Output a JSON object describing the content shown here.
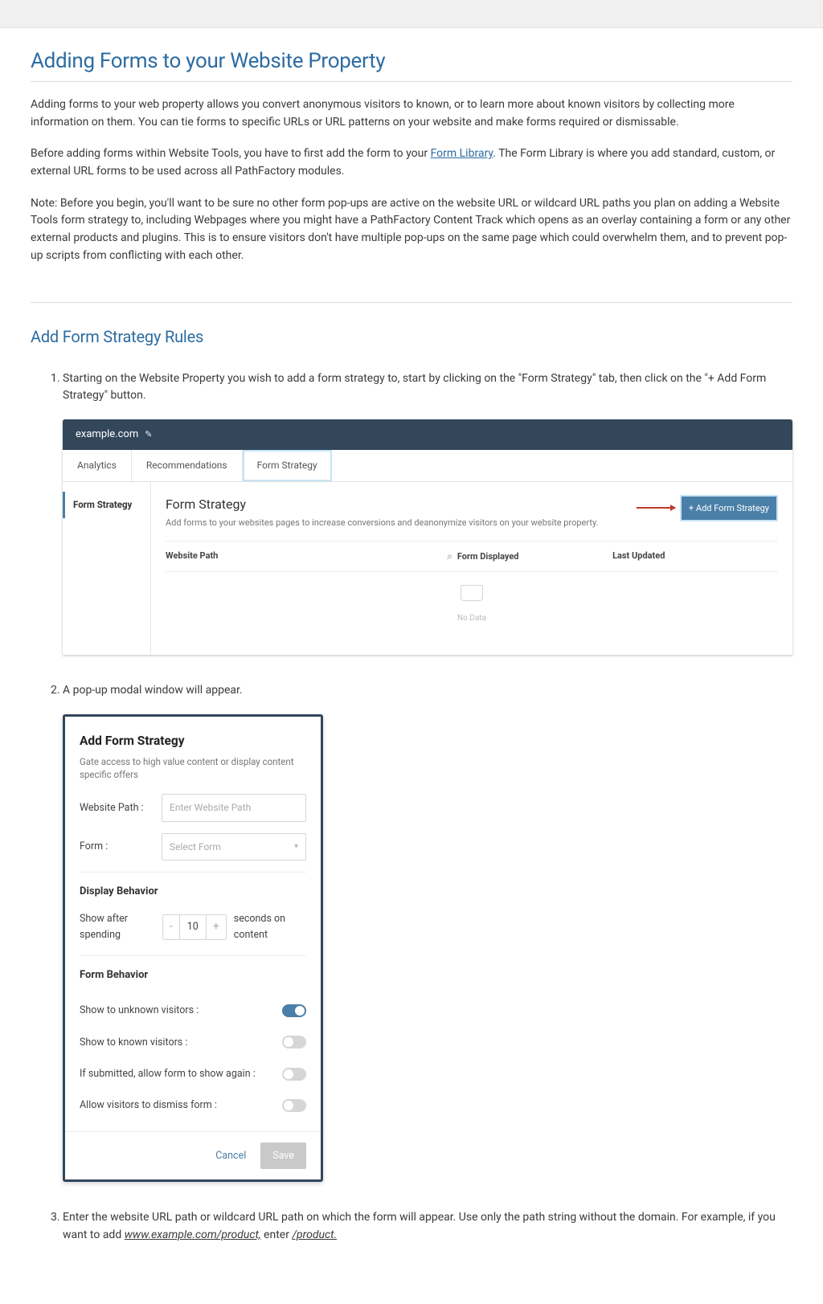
{
  "heading": "Adding Forms to your Website Property",
  "intro_p1": "Adding forms to your web property allows you convert anonymous visitors to known, or to learn more about known visitors by collecting more information on them. You can tie forms to specific URLs or URL patterns on your website and make forms required or dismissable.",
  "intro_p2_a": "Before adding forms within Website Tools, you have to first add the form to your ",
  "intro_p2_link": "Form Library",
  "intro_p2_b": ". The Form Library is where you add standard, custom, or external URL forms to be used across all PathFactory modules.",
  "intro_p3": "Note: Before you begin, you'll want to be sure no other form pop-ups are active on the website URL or wildcard URL paths you plan on adding a Website Tools form strategy to, including Webpages where you might have a PathFactory Content Track which opens as an overlay containing a form or any other external products and plugins. This is to ensure visitors don't have multiple pop-ups on the same page which could overwhelm them, and to prevent pop-up scripts from conflicting with each other.",
  "section_title": "Add Form Strategy Rules",
  "step1": "Starting on the Website Property you wish to add a form strategy to, start by clicking on the \"Form Strategy\" tab, then click on the \"+ Add Form Strategy\" button.",
  "step2": "A pop-up modal window will appear.",
  "step3_a": "Enter the website URL path or wildcard URL path on which the form will appear. Use only the path string without the domain. For example, if you want to add ",
  "step3_url1": "www.example.com/product,",
  "step3_b": " enter ",
  "step3_url2": "/product.",
  "shot1": {
    "breadcrumb": "example.com",
    "tabs": [
      "Analytics",
      "Recommendations",
      "Form Strategy"
    ],
    "side_item": "Form Strategy",
    "panel_title": "Form Strategy",
    "panel_sub": "Add forms to your websites pages to increase conversions and deanonymize visitors on your website property.",
    "btn_label": "+   Add Form Strategy",
    "col1": "Website Path",
    "col2": "Form Displayed",
    "col3": "Last Updated",
    "nodata": "No Data"
  },
  "shot2": {
    "title": "Add Form Strategy",
    "sub": "Gate access to high value content or display content specific offers",
    "website_path_label": "Website Path :",
    "website_path_ph": "Enter Website Path",
    "form_label": "Form :",
    "form_ph": "Select Form",
    "display_behavior": "Display Behavior",
    "show_after_a": "Show after spending",
    "spend_val": "10",
    "show_after_b": "seconds on content",
    "form_behavior": "Form Behavior",
    "t1": "Show to unknown visitors :",
    "t2": "Show to known visitors :",
    "t3": "If submitted, allow form to show again :",
    "t4": "Allow visitors to dismiss form :",
    "cancel": "Cancel",
    "save": "Save"
  }
}
